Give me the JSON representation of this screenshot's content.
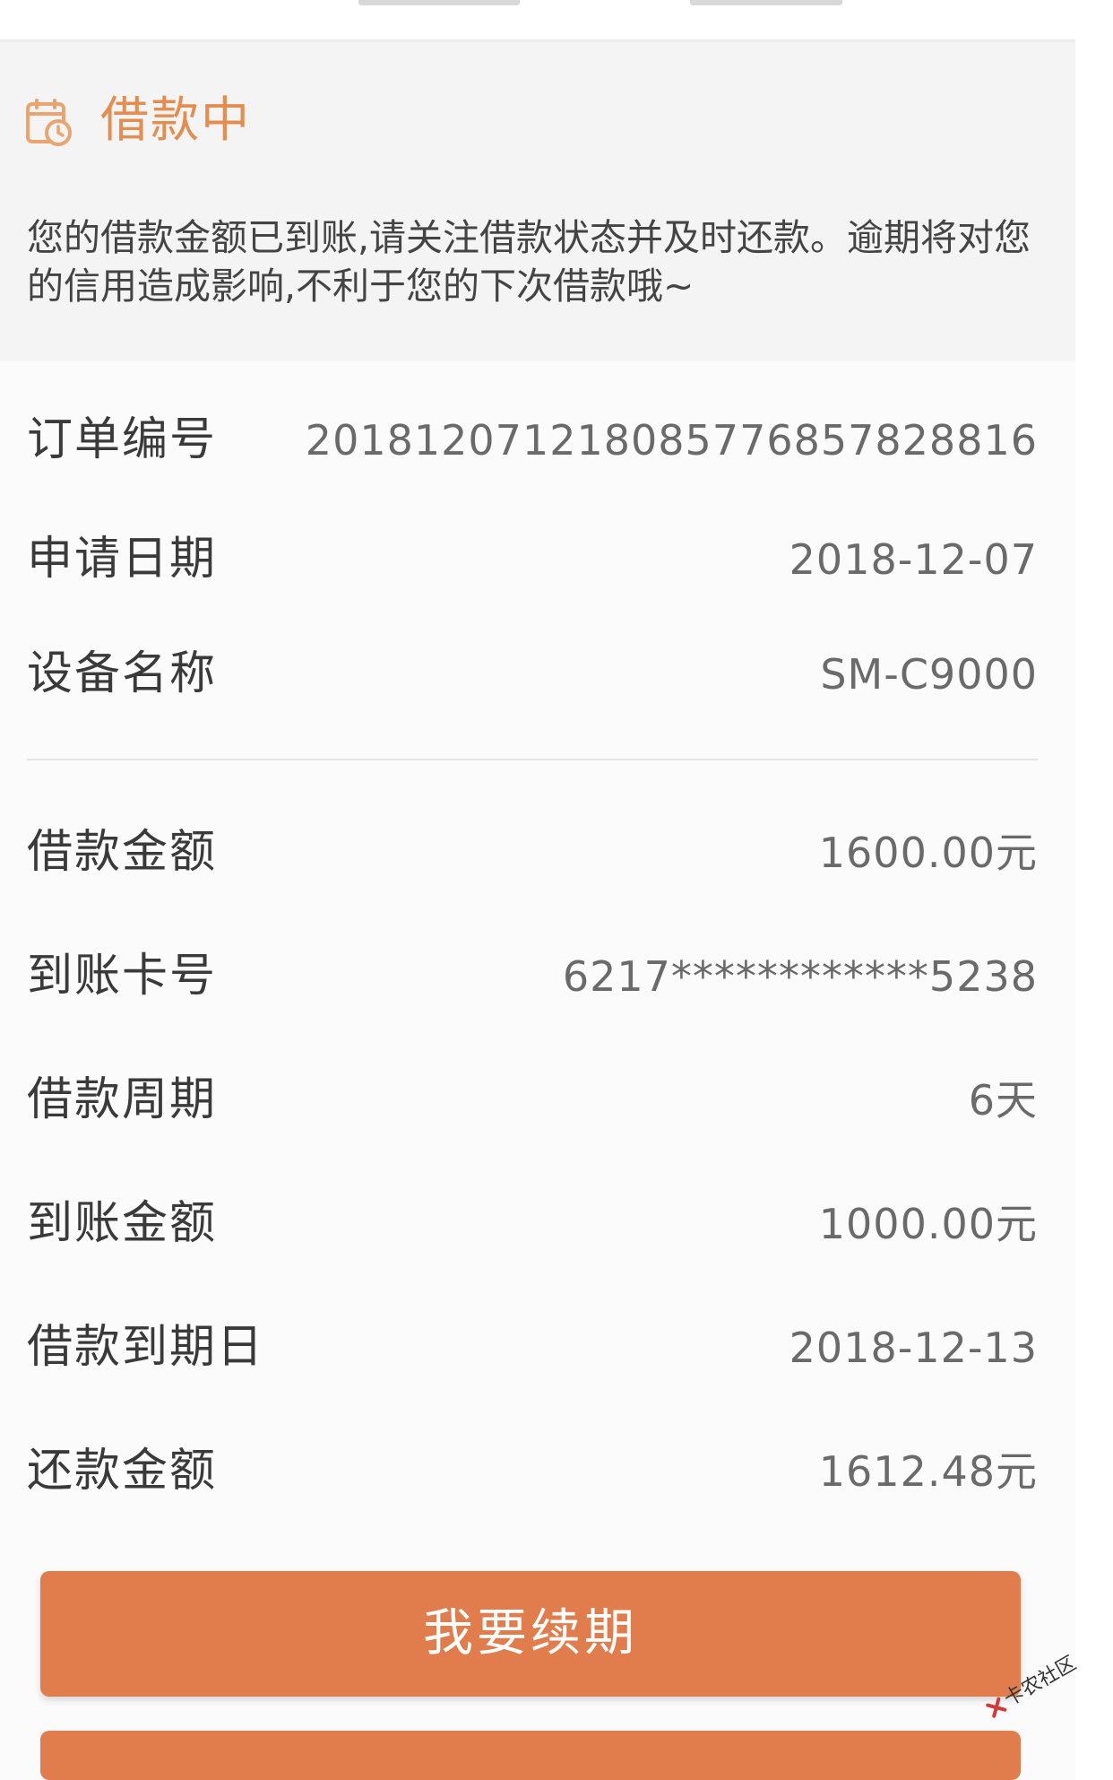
{
  "status": {
    "icon": "calendar-clock-icon",
    "title": "借款中",
    "description": "您的借款金额已到账,请关注借款状态并及时还款。逾期将对您的信用造成影响,不利于您的下次借款哦~"
  },
  "order_info": {
    "order_no": {
      "label": "订单编号",
      "value": "20181207121808577685782881​6"
    },
    "apply_date": {
      "label": "申请日期",
      "value": "2018-12-07"
    },
    "device_name": {
      "label": "设备名称",
      "value": "SM-C9000"
    }
  },
  "loan_info": {
    "loan_amount": {
      "label": "借款金额",
      "value": "1600.00元"
    },
    "card_no": {
      "label": "到账卡号",
      "value": "6217************5238"
    },
    "loan_period": {
      "label": "借款周期",
      "value": "6天"
    },
    "received_amount": {
      "label": "到账金额",
      "value": "1000.00元"
    },
    "due_date": {
      "label": "借款到期日",
      "value": "2018-12-13"
    },
    "repay_amount": {
      "label": "还款金额",
      "value": "1612.48元"
    }
  },
  "actions": {
    "renew_label": "我要续期"
  },
  "watermark": {
    "text": "卡农社区"
  },
  "colors": {
    "accent": "#e48d4f",
    "button": "#e17c4d",
    "card_bg": "#f4f4f4",
    "page_bg": "#fbfbfb"
  }
}
